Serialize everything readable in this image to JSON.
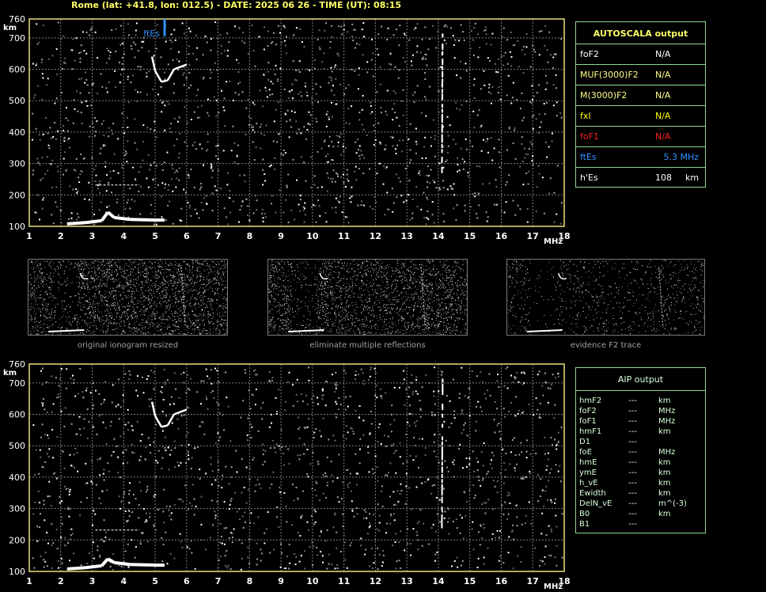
{
  "header": "Rome (lat: +41.8, lon: 012.5) - DATE: 2025 06 26 - TIME (UT): 08:15",
  "colors": {
    "axis_frame": "#e8e07a",
    "grid": "#808080",
    "green_border": "#8fd88f",
    "title_yellow": "#ffff66",
    "fxl_yellow": "#ffff00",
    "foF1_red": "#ff2020",
    "ftEs_blue": "#3090ff"
  },
  "chart_data": [
    {
      "type": "scatter",
      "name": "main-ionogram",
      "xlabel": "MHz",
      "ylabel": "km",
      "xlim": [
        1,
        18
      ],
      "ylim": [
        100,
        760
      ],
      "grid": true,
      "x_ticks": [
        "1",
        "2",
        "3",
        "4",
        "5",
        "6",
        "7",
        "8",
        "9",
        "10",
        "11",
        "12",
        "13",
        "14",
        "15",
        "16",
        "17",
        "18"
      ],
      "y_ticks": [
        "100",
        "200",
        "300",
        "400",
        "500",
        "600",
        "700",
        "760"
      ],
      "annotations": [
        {
          "label": "ftEs",
          "x": 5.3
        }
      ],
      "es_trace": [
        [
          2.2,
          108
        ],
        [
          2.8,
          112
        ],
        [
          3.3,
          118
        ],
        [
          3.5,
          145
        ],
        [
          3.7,
          128
        ],
        [
          4.2,
          122
        ],
        [
          5.0,
          120
        ],
        [
          5.3,
          120
        ]
      ],
      "f2_trace": [
        [
          4.9,
          640
        ],
        [
          5.0,
          595
        ],
        [
          5.2,
          560
        ],
        [
          5.4,
          565
        ],
        [
          5.6,
          600
        ],
        [
          6.0,
          615
        ]
      ],
      "vertical_trace_x": 14.1
    },
    {
      "type": "scatter",
      "name": "aip-ionogram",
      "xlabel": "MHz",
      "ylabel": "km",
      "xlim": [
        1,
        18
      ],
      "ylim": [
        100,
        760
      ],
      "grid": true,
      "x_ticks": [
        "1",
        "2",
        "3",
        "4",
        "5",
        "6",
        "7",
        "8",
        "9",
        "10",
        "11",
        "12",
        "13",
        "14",
        "15",
        "16",
        "17",
        "18"
      ],
      "y_ticks": [
        "100",
        "200",
        "300",
        "400",
        "500",
        "600",
        "700",
        "760"
      ],
      "es_trace": [
        [
          2.2,
          108
        ],
        [
          2.8,
          112
        ],
        [
          3.3,
          118
        ],
        [
          3.5,
          140
        ],
        [
          3.7,
          128
        ],
        [
          4.2,
          122
        ],
        [
          5.0,
          120
        ],
        [
          5.3,
          120
        ]
      ],
      "f2_trace": [
        [
          4.9,
          640
        ],
        [
          5.0,
          595
        ],
        [
          5.2,
          560
        ],
        [
          5.4,
          565
        ],
        [
          5.6,
          600
        ],
        [
          6.0,
          615
        ]
      ],
      "vertical_trace_x": 14.1
    }
  ],
  "thumbs": [
    {
      "caption": "original ionogram resized"
    },
    {
      "caption": "eliminate multiple reflections"
    },
    {
      "caption": "evidence F2 trace"
    }
  ],
  "autoscala": {
    "title": "AUTOSCALA output",
    "rows": [
      {
        "label": "foF2",
        "value": "N/A",
        "color": "#ffffff"
      },
      {
        "label": "MUF(3000)F2",
        "value": "N/A",
        "color": "#ffff88"
      },
      {
        "label": "M(3000)F2",
        "value": "N/A",
        "color": "#ffff88"
      },
      {
        "label": "fxI",
        "value": "N/A",
        "color": "#ffff00"
      },
      {
        "label": "foF1",
        "value": "N/A",
        "color": "#ff2020"
      },
      {
        "label": "ftEs",
        "value": "5.3 MHz",
        "color": "#3090ff"
      },
      {
        "label": "h'Es",
        "value": "108",
        "unit": "km",
        "color": "#ffffff"
      }
    ]
  },
  "aip": {
    "title": "AIP output",
    "rows": [
      {
        "label": "hmF2",
        "value": "---",
        "unit": "km"
      },
      {
        "label": "foF2",
        "value": "---",
        "unit": "MHz"
      },
      {
        "label": "foF1",
        "value": "---",
        "unit": "MHz"
      },
      {
        "label": "hmF1",
        "value": "---",
        "unit": "km"
      },
      {
        "label": "D1",
        "value": "---",
        "unit": ""
      },
      {
        "label": "foE",
        "value": "---",
        "unit": "MHz"
      },
      {
        "label": "hmE",
        "value": "---",
        "unit": "km"
      },
      {
        "label": "ymE",
        "value": "---",
        "unit": "km"
      },
      {
        "label": "h_vE",
        "value": "---",
        "unit": "km"
      },
      {
        "label": "Ewidth",
        "value": "---",
        "unit": "km"
      },
      {
        "label": "DelN_vE",
        "value": "---",
        "unit": "m^(-3)"
      },
      {
        "label": "B0",
        "value": "---",
        "unit": "km"
      },
      {
        "label": "B1",
        "value": "---",
        "unit": ""
      }
    ]
  }
}
